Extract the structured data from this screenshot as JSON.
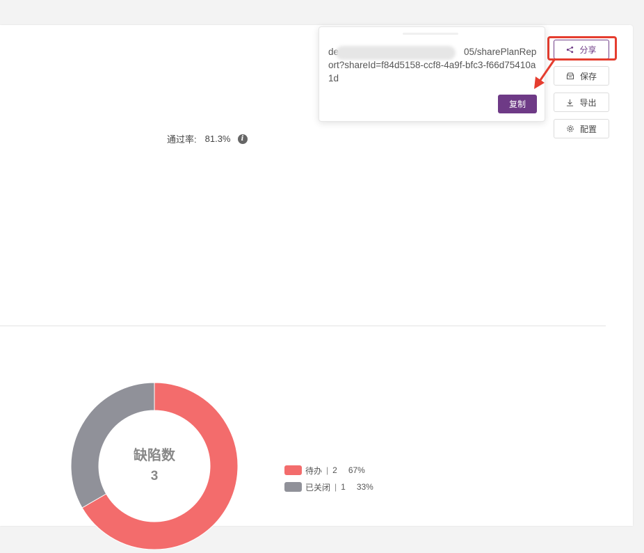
{
  "toolbar": {
    "share_label": "分享",
    "save_label": "保存",
    "export_label": "导出",
    "config_label": "配置"
  },
  "share_popover": {
    "url_visible_start": "de",
    "url_visible_rest": "05/sharePlanReport?shareId=f84d5158-ccf8-4a9f-bfc3-f66d75410a1d",
    "copy_label": "复制"
  },
  "summary": {
    "pass_rate_label": "通过率:",
    "pass_rate_value": "81.3%"
  },
  "defects": {
    "title": "缺陷数",
    "total": "3",
    "legend": [
      {
        "name": "待办",
        "count": "2",
        "percent": "67%",
        "color": "#f36c6c"
      },
      {
        "name": "已关闭",
        "count": "1",
        "percent": "33%",
        "color": "#909199"
      }
    ]
  },
  "chart_data": {
    "type": "pie",
    "title": "缺陷数",
    "categories": [
      "待办",
      "已关闭"
    ],
    "values": [
      2,
      1
    ],
    "percentages": [
      67,
      33
    ],
    "colors": [
      "#f36c6c",
      "#909199"
    ],
    "center_value": 3
  }
}
